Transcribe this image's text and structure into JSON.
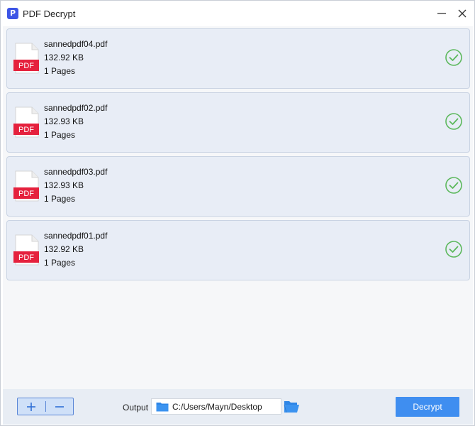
{
  "window": {
    "title": "PDF Decrypt",
    "logo_letter": "P"
  },
  "files": [
    {
      "name": "sannedpdf04.pdf",
      "size": "132.92 KB",
      "pages": "1 Pages",
      "icon_label": "PDF",
      "status": "done-check-icon"
    },
    {
      "name": "sannedpdf02.pdf",
      "size": "132.93 KB",
      "pages": "1 Pages",
      "icon_label": "PDF",
      "status": "done-check-icon"
    },
    {
      "name": "sannedpdf03.pdf",
      "size": "132.93 KB",
      "pages": "1 Pages",
      "icon_label": "PDF",
      "status": "done-check-icon"
    },
    {
      "name": "sannedpdf01.pdf",
      "size": "132.92 KB",
      "pages": "1 Pages",
      "icon_label": "PDF",
      "status": "done-check-icon"
    }
  ],
  "bottom": {
    "output_label": "Output",
    "output_path": "C:/Users/Mayn/Desktop",
    "decrypt_label": "Decrypt"
  },
  "colors": {
    "accent": "#3f8ef0",
    "logo": "#3d55e6",
    "pdf_badge": "#e5213d",
    "check": "#5cb85c",
    "card_bg": "#e8edf6"
  }
}
